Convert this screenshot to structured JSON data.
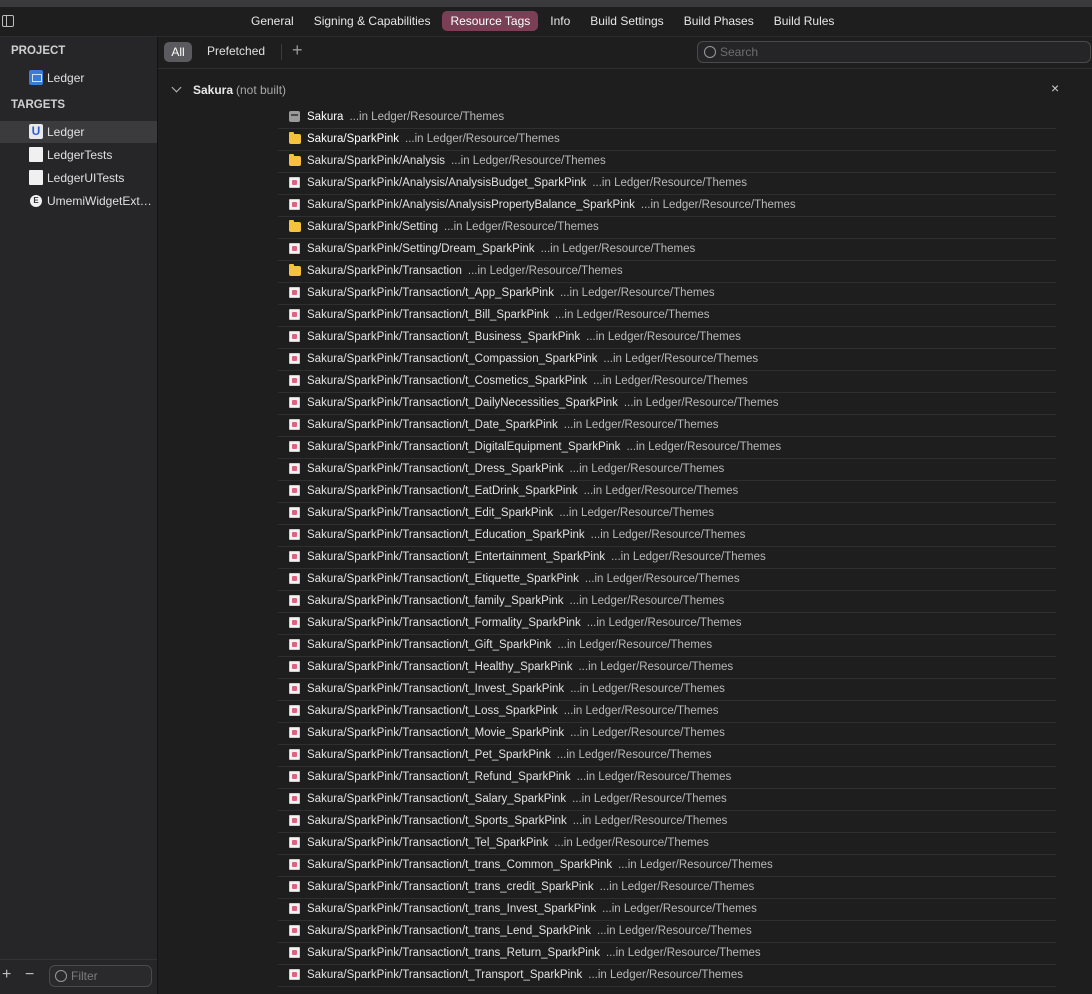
{
  "tabs": [
    {
      "label": "General",
      "active": false
    },
    {
      "label": "Signing & Capabilities",
      "active": false
    },
    {
      "label": "Resource Tags",
      "active": true
    },
    {
      "label": "Info",
      "active": false
    },
    {
      "label": "Build Settings",
      "active": false
    },
    {
      "label": "Build Phases",
      "active": false
    },
    {
      "label": "Build Rules",
      "active": false
    }
  ],
  "sidebar": {
    "project_title": "PROJECT",
    "project_item": "Ledger",
    "targets_title": "TARGETS",
    "targets": [
      {
        "label": "Ledger",
        "icon": "app-icon",
        "selected": true
      },
      {
        "label": "LedgerTests",
        "icon": "test-bundle-icon",
        "selected": false
      },
      {
        "label": "LedgerUITests",
        "icon": "test-bundle-icon",
        "selected": false
      },
      {
        "label": "UmemiWidgetExtension",
        "icon": "extension-icon",
        "selected": false
      }
    ],
    "add_symbol": "+",
    "remove_symbol": "−",
    "filter_placeholder": "Filter"
  },
  "toolbar": {
    "all_label": "All",
    "prefetched_label": "Prefetched",
    "add_symbol": "+",
    "search_placeholder": "Search"
  },
  "group": {
    "name": "Sakura",
    "status": "(not built)",
    "close_symbol": "×"
  },
  "resources": [
    {
      "name": "Sakura",
      "path": "...in Ledger/Resource/Themes",
      "icon": "group"
    },
    {
      "name": "Sakura/SparkPink",
      "path": "...in Ledger/Resource/Themes",
      "icon": "folder"
    },
    {
      "name": "Sakura/SparkPink/Analysis",
      "path": "...in Ledger/Resource/Themes",
      "icon": "folder"
    },
    {
      "name": "Sakura/SparkPink/Analysis/AnalysisBudget_SparkPink",
      "path": "...in Ledger/Resource/Themes",
      "icon": "image"
    },
    {
      "name": "Sakura/SparkPink/Analysis/AnalysisPropertyBalance_SparkPink",
      "path": "...in Ledger/Resource/Themes",
      "icon": "image"
    },
    {
      "name": "Sakura/SparkPink/Setting",
      "path": "...in Ledger/Resource/Themes",
      "icon": "folder"
    },
    {
      "name": "Sakura/SparkPink/Setting/Dream_SparkPink",
      "path": "...in Ledger/Resource/Themes",
      "icon": "image"
    },
    {
      "name": "Sakura/SparkPink/Transaction",
      "path": "...in Ledger/Resource/Themes",
      "icon": "folder"
    },
    {
      "name": "Sakura/SparkPink/Transaction/t_App_SparkPink",
      "path": "...in Ledger/Resource/Themes",
      "icon": "image"
    },
    {
      "name": "Sakura/SparkPink/Transaction/t_Bill_SparkPink",
      "path": "...in Ledger/Resource/Themes",
      "icon": "image"
    },
    {
      "name": "Sakura/SparkPink/Transaction/t_Business_SparkPink",
      "path": "...in Ledger/Resource/Themes",
      "icon": "image"
    },
    {
      "name": "Sakura/SparkPink/Transaction/t_Compassion_SparkPink",
      "path": "...in Ledger/Resource/Themes",
      "icon": "image"
    },
    {
      "name": "Sakura/SparkPink/Transaction/t_Cosmetics_SparkPink",
      "path": "...in Ledger/Resource/Themes",
      "icon": "image"
    },
    {
      "name": "Sakura/SparkPink/Transaction/t_DailyNecessities_SparkPink",
      "path": "...in Ledger/Resource/Themes",
      "icon": "image"
    },
    {
      "name": "Sakura/SparkPink/Transaction/t_Date_SparkPink",
      "path": "...in Ledger/Resource/Themes",
      "icon": "image"
    },
    {
      "name": "Sakura/SparkPink/Transaction/t_DigitalEquipment_SparkPink",
      "path": "...in Ledger/Resource/Themes",
      "icon": "image"
    },
    {
      "name": "Sakura/SparkPink/Transaction/t_Dress_SparkPink",
      "path": "...in Ledger/Resource/Themes",
      "icon": "image"
    },
    {
      "name": "Sakura/SparkPink/Transaction/t_EatDrink_SparkPink",
      "path": "...in Ledger/Resource/Themes",
      "icon": "image"
    },
    {
      "name": "Sakura/SparkPink/Transaction/t_Edit_SparkPink",
      "path": "...in Ledger/Resource/Themes",
      "icon": "image"
    },
    {
      "name": "Sakura/SparkPink/Transaction/t_Education_SparkPink",
      "path": "...in Ledger/Resource/Themes",
      "icon": "image"
    },
    {
      "name": "Sakura/SparkPink/Transaction/t_Entertainment_SparkPink",
      "path": "...in Ledger/Resource/Themes",
      "icon": "image"
    },
    {
      "name": "Sakura/SparkPink/Transaction/t_Etiquette_SparkPink",
      "path": "...in Ledger/Resource/Themes",
      "icon": "image"
    },
    {
      "name": "Sakura/SparkPink/Transaction/t_family_SparkPink",
      "path": "...in Ledger/Resource/Themes",
      "icon": "image"
    },
    {
      "name": "Sakura/SparkPink/Transaction/t_Formality_SparkPink",
      "path": "...in Ledger/Resource/Themes",
      "icon": "image"
    },
    {
      "name": "Sakura/SparkPink/Transaction/t_Gift_SparkPink",
      "path": "...in Ledger/Resource/Themes",
      "icon": "image"
    },
    {
      "name": "Sakura/SparkPink/Transaction/t_Healthy_SparkPink",
      "path": "...in Ledger/Resource/Themes",
      "icon": "image"
    },
    {
      "name": "Sakura/SparkPink/Transaction/t_Invest_SparkPink",
      "path": "...in Ledger/Resource/Themes",
      "icon": "image"
    },
    {
      "name": "Sakura/SparkPink/Transaction/t_Loss_SparkPink",
      "path": "...in Ledger/Resource/Themes",
      "icon": "image"
    },
    {
      "name": "Sakura/SparkPink/Transaction/t_Movie_SparkPink",
      "path": "...in Ledger/Resource/Themes",
      "icon": "image"
    },
    {
      "name": "Sakura/SparkPink/Transaction/t_Pet_SparkPink",
      "path": "...in Ledger/Resource/Themes",
      "icon": "image"
    },
    {
      "name": "Sakura/SparkPink/Transaction/t_Refund_SparkPink",
      "path": "...in Ledger/Resource/Themes",
      "icon": "image"
    },
    {
      "name": "Sakura/SparkPink/Transaction/t_Salary_SparkPink",
      "path": "...in Ledger/Resource/Themes",
      "icon": "image"
    },
    {
      "name": "Sakura/SparkPink/Transaction/t_Sports_SparkPink",
      "path": "...in Ledger/Resource/Themes",
      "icon": "image"
    },
    {
      "name": "Sakura/SparkPink/Transaction/t_Tel_SparkPink",
      "path": "...in Ledger/Resource/Themes",
      "icon": "image"
    },
    {
      "name": "Sakura/SparkPink/Transaction/t_trans_Common_SparkPink",
      "path": "...in Ledger/Resource/Themes",
      "icon": "image"
    },
    {
      "name": "Sakura/SparkPink/Transaction/t_trans_credit_SparkPink",
      "path": "...in Ledger/Resource/Themes",
      "icon": "image"
    },
    {
      "name": "Sakura/SparkPink/Transaction/t_trans_Invest_SparkPink",
      "path": "...in Ledger/Resource/Themes",
      "icon": "image"
    },
    {
      "name": "Sakura/SparkPink/Transaction/t_trans_Lend_SparkPink",
      "path": "...in Ledger/Resource/Themes",
      "icon": "image"
    },
    {
      "name": "Sakura/SparkPink/Transaction/t_trans_Return_SparkPink",
      "path": "...in Ledger/Resource/Themes",
      "icon": "image"
    },
    {
      "name": "Sakura/SparkPink/Transaction/t_Transport_SparkPink",
      "path": "...in Ledger/Resource/Themes",
      "icon": "image"
    }
  ],
  "colors": {
    "accent_tab": "#7b3f55",
    "folder": "#f5c33b",
    "background": "#1e1e1e",
    "sidebar": "#262628"
  }
}
